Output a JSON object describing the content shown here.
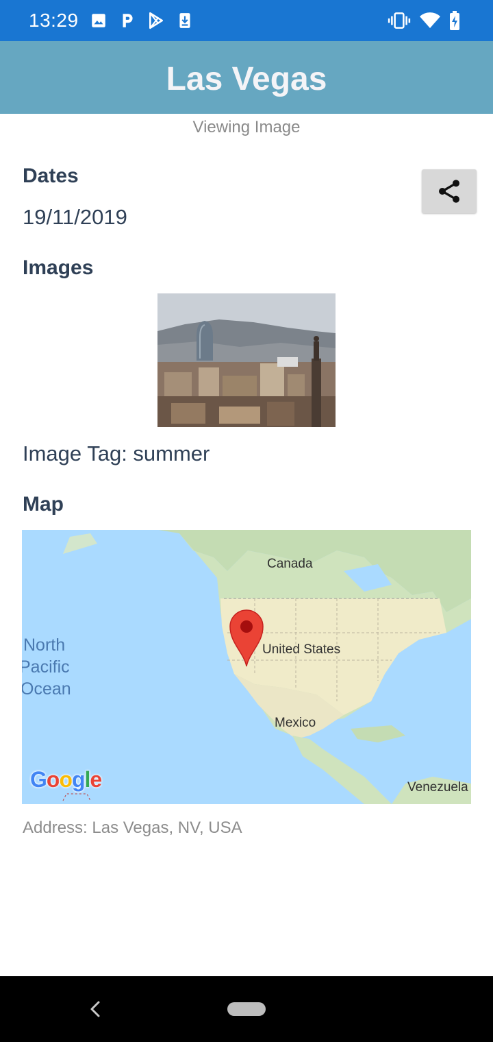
{
  "status_bar": {
    "time": "13:29",
    "icons": [
      "image-icon",
      "p-app-icon",
      "play-store-icon",
      "download-icon",
      "vibrate-icon",
      "wifi-icon",
      "battery-charging-icon"
    ],
    "background": "#1976d2"
  },
  "app_bar": {
    "title": "Las Vegas",
    "background": "#66a7c1"
  },
  "subtitle": "Viewing Image",
  "dates": {
    "heading": "Dates",
    "value": "19/11/2019"
  },
  "share_icon": "share-icon",
  "images": {
    "heading": "Images",
    "image_tag_label": "Image Tag: summer"
  },
  "map": {
    "heading": "Map",
    "labels": {
      "canada": "Canada",
      "united_states": "United States",
      "mexico": "Mexico",
      "venezuela": "Venezuela",
      "ocean_line1": "North",
      "ocean_line2": "Pacific",
      "ocean_line3": "Ocean"
    },
    "logo": [
      "G",
      "o",
      "o",
      "g",
      "l",
      "e"
    ],
    "pin_color": "#ea4335"
  },
  "address": "Address: Las Vegas, NV, USA",
  "nav": {
    "back_icon": "back-chevron-icon"
  }
}
